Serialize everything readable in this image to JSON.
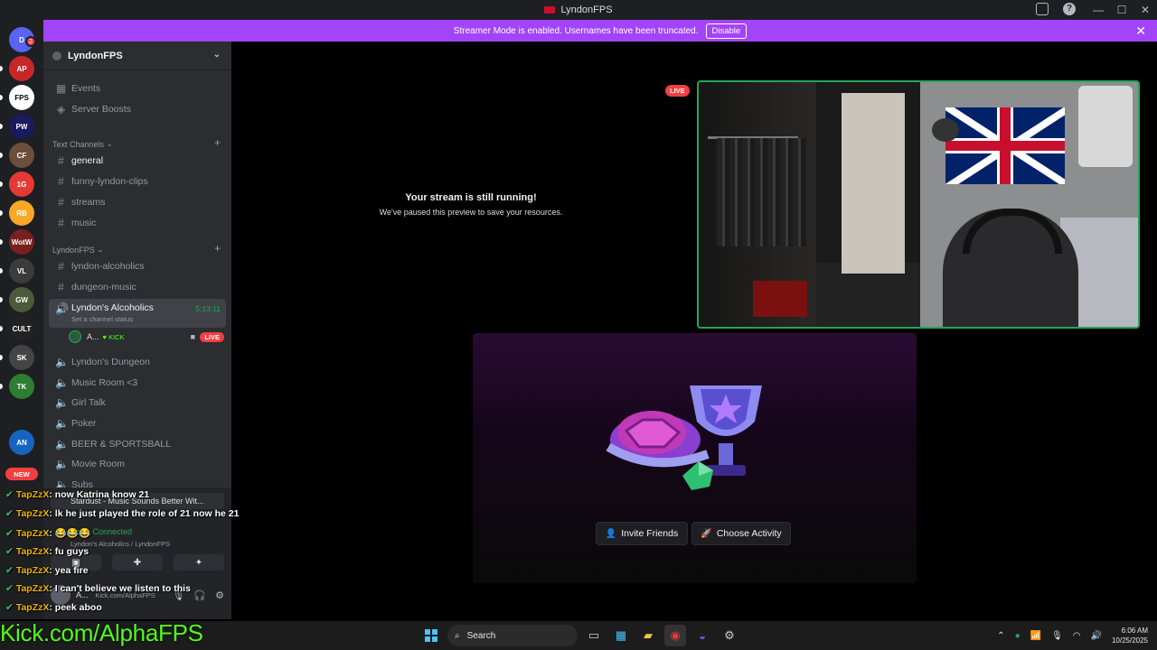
{
  "window": {
    "title": "LyndonFPS",
    "controls": [
      "—",
      "☐",
      "✕"
    ]
  },
  "banner": {
    "text": "Streamer Mode is enabled. Usernames have been truncated.",
    "disable_label": "Disable"
  },
  "rail": {
    "new_label": "NEW",
    "notification_count": "2",
    "servers": [
      {
        "abbr": "D",
        "color": "#5865f2"
      },
      {
        "abbr": "AP",
        "color": "#c62828"
      },
      {
        "abbr": "FPS",
        "color": "#ffffff"
      },
      {
        "abbr": "PW",
        "color": "#1a1a5e"
      },
      {
        "abbr": "CF",
        "color": "#6b4f3a"
      },
      {
        "abbr": "1G",
        "color": "#e53935"
      },
      {
        "abbr": "RB",
        "color": "#f9a825"
      },
      {
        "abbr": "WotW",
        "color": "#7a1f1f"
      },
      {
        "abbr": "VL",
        "color": "#3b3b3b"
      },
      {
        "abbr": "GW",
        "color": "#4a5a3a"
      },
      {
        "abbr": "CULT",
        "color": "#222222"
      },
      {
        "abbr": "SK",
        "color": "#444444"
      },
      {
        "abbr": "TK",
        "color": "#2e7d32"
      },
      {
        "abbr": "AN",
        "color": "#1565c0"
      }
    ]
  },
  "sidebar": {
    "guild_name": "LyndonFPS",
    "top_items": [
      "Events",
      "Server Boosts"
    ],
    "categories": [
      {
        "label": "Text Channels"
      },
      {
        "label": "LyndonFPS"
      }
    ],
    "text_channels": [
      "general",
      "funny-lyndon-clips",
      "streams",
      "music"
    ],
    "lyndon_channels": [
      "lyndon-alcoholics",
      "dungeon-music"
    ],
    "active_voice": {
      "name": "Lyndon's Alcoholics",
      "timer": "5:13:11",
      "status": "Set a channel status"
    },
    "voice_user": {
      "name": "A...",
      "tag": "KICK",
      "live": "LIVE"
    },
    "voice_channels": [
      "Lyndon's Dungeon",
      "Music Room <3",
      "Girl Talk",
      "Poker",
      "BEER & SPORTSBALL",
      "Movie Room",
      "Subs"
    ]
  },
  "voice_panel": {
    "song": "Stardust - Music Sounds Better Wit...",
    "connected": "Voice Connected",
    "location": "Lyndon's Alcoholics / LyndonFPS",
    "user_name": "A...",
    "user_status": "Kick.com/AlphaFPS"
  },
  "main": {
    "paused_title": "Your stream is still running!",
    "paused_sub": "We've paused this preview to save your resources.",
    "live_tag": "LIVE",
    "invite_label": "Invite Friends",
    "activity_label": "Choose Activity"
  },
  "chat": [
    {
      "user": "TapZzX",
      "text": "now Katrina know 21"
    },
    {
      "user": "TapZzX",
      "text": "lk he just played the role of 21 now he 21"
    },
    {
      "user": "TapZzX",
      "text": "😂😂😂"
    },
    {
      "user": "TapZzX",
      "text": "fu guys"
    },
    {
      "user": "TapZzX",
      "text": "yea fire"
    },
    {
      "user": "TapZzX",
      "text": "I can't believe we listen to this"
    },
    {
      "user": "TapZzX",
      "text": "peek aboo"
    }
  ],
  "overlay_url": "Kick.com/AlphaFPS",
  "taskbar": {
    "search_label": "Search",
    "time": "6:06 AM",
    "date": "10/25/2025"
  }
}
